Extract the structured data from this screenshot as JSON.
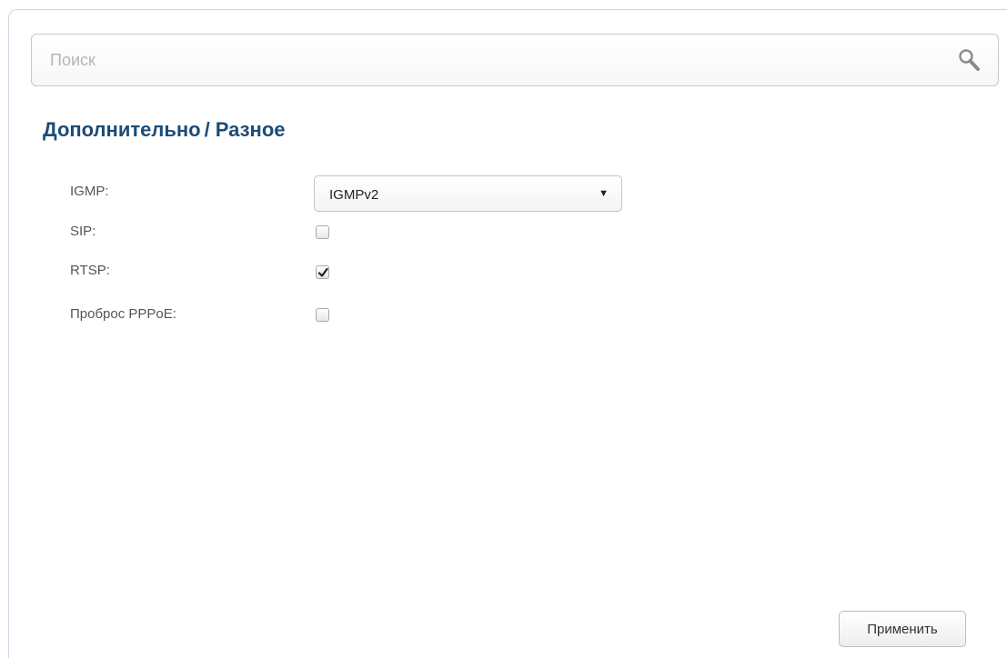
{
  "search": {
    "placeholder": "Поиск",
    "value": ""
  },
  "breadcrumb": {
    "parent": "Дополнительно",
    "separator": "/",
    "current": "Разное"
  },
  "form": {
    "igmp": {
      "label": "IGMP:",
      "selected": "IGMPv2"
    },
    "sip": {
      "label": "SIP:",
      "checked": false
    },
    "rtsp": {
      "label": "RTSP:",
      "checked": true
    },
    "pppoe": {
      "label": "Проброс PPPoE:",
      "checked": false
    }
  },
  "actions": {
    "apply_label": "Применить"
  },
  "colors": {
    "title": "#1c4c78",
    "label": "#555555",
    "border": "#c9d7e3"
  },
  "icons": {
    "search": "search-icon",
    "dropdown": "chevron-down-icon",
    "check": "checkmark-icon"
  }
}
